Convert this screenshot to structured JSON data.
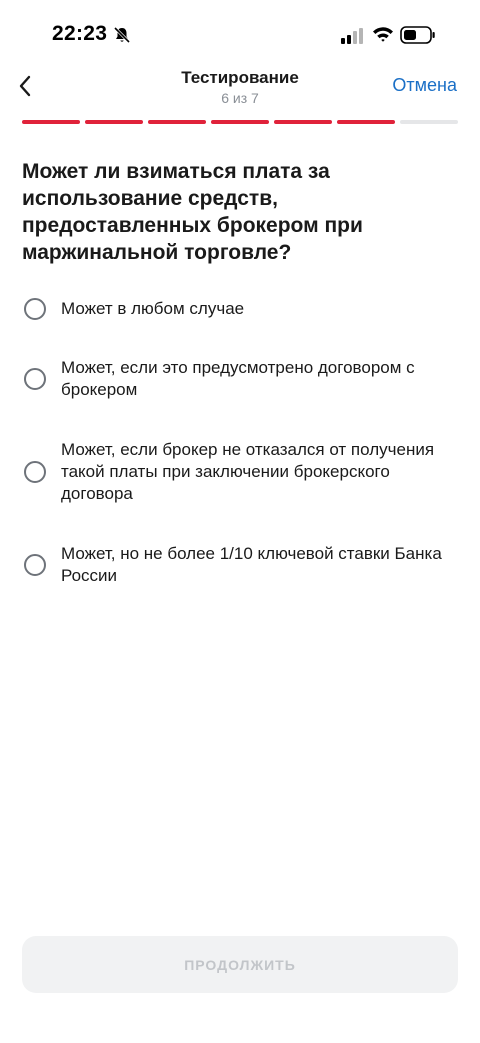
{
  "status_bar": {
    "time": "22:23",
    "icons": [
      "bell-slash-icon",
      "cellular-signal-icon",
      "wifi-icon",
      "battery-icon"
    ]
  },
  "nav": {
    "title": "Тестирование",
    "subtitle": "6 из 7",
    "cancel_label": "Отмена",
    "back_icon": "chevron-left-icon"
  },
  "progress": {
    "current": 6,
    "total": 7,
    "active_color": "#e0223a",
    "inactive_color": "#e5e6e8"
  },
  "question": "Может ли взиматься плата за использование средств, предоставленных брокером при маржинальной торговле?",
  "options": [
    {
      "text": "Может в любом случае",
      "selected": false
    },
    {
      "text": "Может, если это предусмотрено договором с брокером",
      "selected": false
    },
    {
      "text": "Может, если брокер не отказался от получения такой платы при заключении брокерского договора",
      "selected": false
    },
    {
      "text": "Может, но не более 1/10 ключевой ставки Банка России",
      "selected": false
    }
  ],
  "continue_button": {
    "label": "ПРОДОЛЖИТЬ",
    "enabled": false
  },
  "colors": {
    "accent_link": "#1a6fc6",
    "text": "#1a1a1a",
    "muted": "#8a8f96"
  }
}
